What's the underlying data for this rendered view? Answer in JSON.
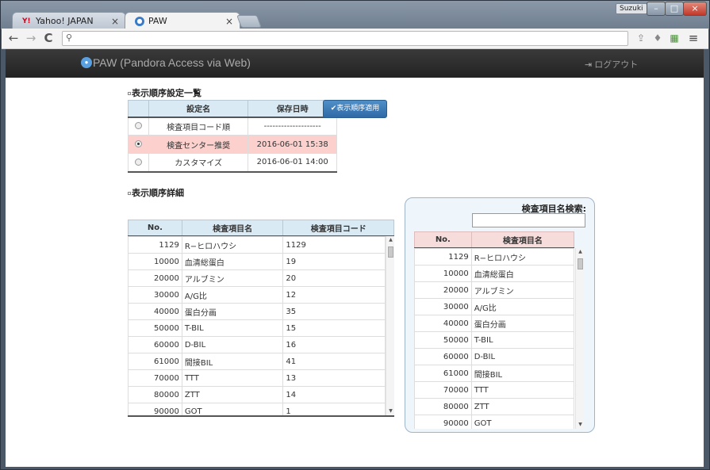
{
  "browser": {
    "tabs": [
      {
        "label": "Yahoo! JAPAN",
        "close": "×",
        "icon": "yahoo-favicon"
      },
      {
        "label": "PAW",
        "close": "×",
        "icon": "paw-favicon"
      }
    ],
    "user": "Suzuki",
    "window_controls": {
      "minimize": "–",
      "maximize": "□",
      "close": "×"
    },
    "nav": {
      "back": "←",
      "forward": "→",
      "reload": "C"
    },
    "address": {
      "value": "",
      "placeholder": ""
    },
    "toolbar_icons": [
      "share-icon",
      "pin-icon",
      "extension-icon",
      "menu-icon"
    ],
    "menu_glyph": "≡"
  },
  "app": {
    "brand": "PAW (Pandora Access via Web)",
    "logout": "ログアウト"
  },
  "settings": {
    "title": "表示順序設定一覧",
    "columns": [
      "",
      "設定名",
      "保存日時"
    ],
    "rows": [
      {
        "name": "検査項目コード順",
        "saved": "--------------------",
        "selected": false
      },
      {
        "name": "検査センター推奨",
        "saved": "2016-06-01 15:38",
        "selected": true
      },
      {
        "name": "カスタマイズ",
        "saved": "2016-06-01 14:00",
        "selected": false
      }
    ],
    "apply_button": "表示順序適用"
  },
  "detail": {
    "title": "表示順序詳細",
    "columns": [
      "No.",
      "検査項目名",
      "検査項目コード"
    ],
    "rows": [
      [
        "1129",
        "R−ヒロハウシ",
        "1129"
      ],
      [
        "10000",
        "血清総蛋白",
        "19"
      ],
      [
        "20000",
        "アルブミン",
        "20"
      ],
      [
        "30000",
        "A/G比",
        "12"
      ],
      [
        "40000",
        "蛋白分画",
        "35"
      ],
      [
        "50000",
        "T-BIL",
        "15"
      ],
      [
        "60000",
        "D-BIL",
        "16"
      ],
      [
        "61000",
        "間接BIL",
        "41"
      ],
      [
        "70000",
        "TTT",
        "13"
      ],
      [
        "80000",
        "ZTT",
        "14"
      ],
      [
        "90000",
        "GOT",
        "1"
      ]
    ]
  },
  "search": {
    "label": "検査項目名検索:",
    "value": "",
    "columns": [
      "No.",
      "検査項目名"
    ],
    "rows": [
      [
        "1129",
        "R−ヒロハウシ"
      ],
      [
        "10000",
        "血清総蛋白"
      ],
      [
        "20000",
        "アルブミン"
      ],
      [
        "30000",
        "A/G比"
      ],
      [
        "40000",
        "蛋白分画"
      ],
      [
        "50000",
        "T-BIL"
      ],
      [
        "60000",
        "D-BIL"
      ],
      [
        "61000",
        "間接BIL"
      ],
      [
        "70000",
        "TTT"
      ],
      [
        "80000",
        "ZTT"
      ],
      [
        "90000",
        "GOT"
      ]
    ]
  }
}
